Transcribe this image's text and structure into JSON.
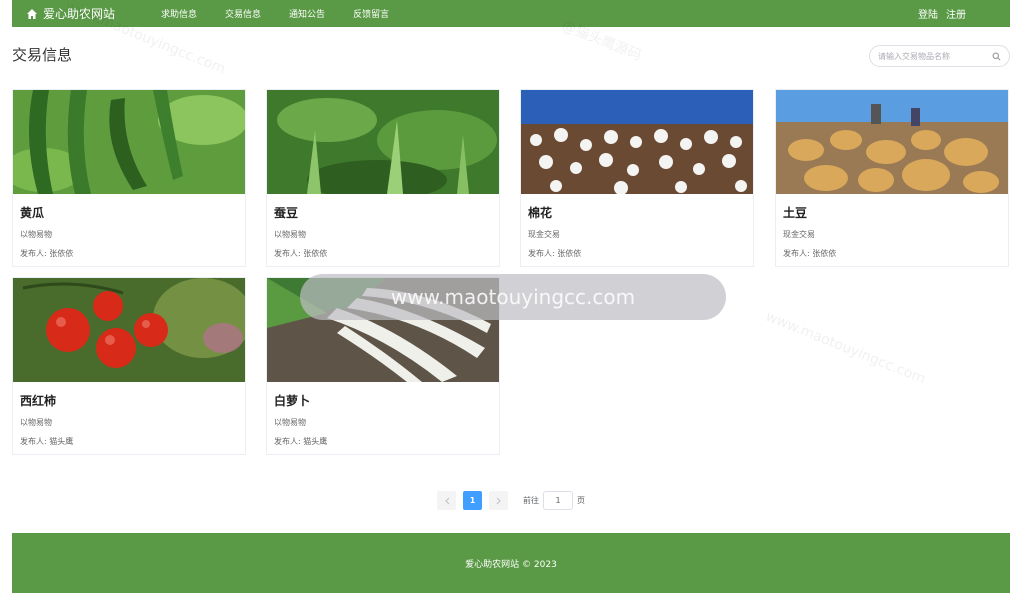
{
  "header": {
    "brand": "爱心助农网站",
    "nav": [
      "求助信息",
      "交易信息",
      "通知公告",
      "反馈留言"
    ],
    "login": "登陆",
    "register": "注册"
  },
  "main": {
    "title": "交易信息",
    "search_placeholder": "请输入交易物品名称"
  },
  "products": [
    {
      "name": "黄瓜",
      "type": "以物易物",
      "publisher": "发布人: 张依依",
      "image": "cucumber"
    },
    {
      "name": "蚕豆",
      "type": "以物易物",
      "publisher": "发布人: 张依依",
      "image": "broad-bean"
    },
    {
      "name": "棉花",
      "type": "现金交易",
      "publisher": "发布人: 张依依",
      "image": "cotton"
    },
    {
      "name": "土豆",
      "type": "现金交易",
      "publisher": "发布人: 张依依",
      "image": "potato"
    },
    {
      "name": "西红柿",
      "type": "以物易物",
      "publisher": "发布人: 猫头鹰",
      "image": "tomato"
    },
    {
      "name": "白萝卜",
      "type": "以物易物",
      "publisher": "发布人: 猫头鹰",
      "image": "radish"
    }
  ],
  "pagination": {
    "current": "1",
    "goto_label": "前往",
    "goto_value": "1",
    "page_suffix": "页"
  },
  "footer": {
    "text": "爱心助农网站 © 2023"
  },
  "watermark": {
    "text": "@猫头鹰源码",
    "url": "www.maotouyingcc.com"
  },
  "colors": {
    "header_green": "#5a9a46",
    "accent_blue": "#409eff"
  }
}
